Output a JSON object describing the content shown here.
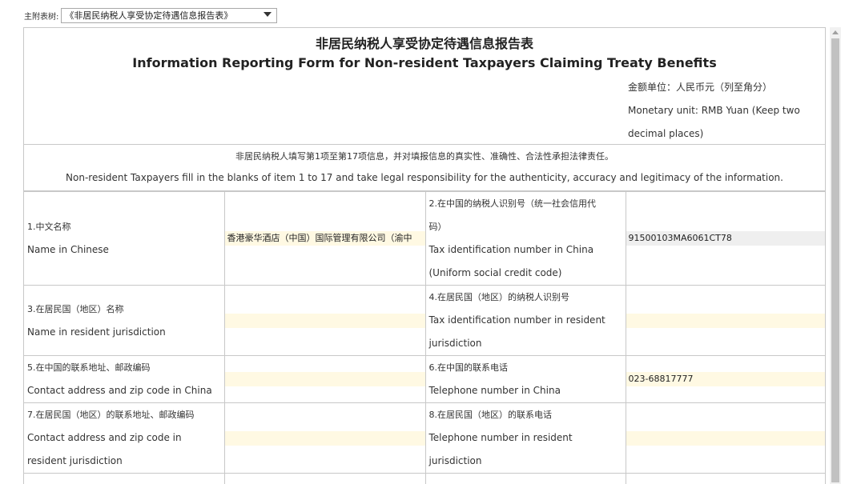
{
  "topbar": {
    "label": "主附表树:",
    "selected": "《非居民纳税人享受协定待遇信息报告表》"
  },
  "form": {
    "title_cn": "非居民纳税人享受协定待遇信息报告表",
    "title_en": "Information Reporting Form for Non-resident Taxpayers Claiming Treaty Benefits",
    "unit_cn": "金额单位：人民币元（列至角分）",
    "unit_en_1": "Monetary unit: RMB Yuan (Keep two",
    "unit_en_2": "decimal places)",
    "notice_cn": "非居民纳税人填写第1项至第17项信息，并对填报信息的真实性、准确性、合法性承担法律责任。",
    "notice_en": "Non-resident Taxpayers fill in the blanks of item 1 to 17 and take legal responsibility for the authenticity, accuracy and legitimacy of the information."
  },
  "rows": [
    {
      "l_cn": "1.中文名称",
      "l_en": "Name in Chinese",
      "l_val": "香港豪华酒店（中国）国际管理有限公司（渝中",
      "r_cn1": "2.在中国的纳税人识别号（统一社会信用代",
      "r_cn2": "码）",
      "r_en1": "Tax identification number in China",
      "r_en2": "(Uniform social credit code)",
      "r_val": "91500103MA6061CT78"
    },
    {
      "l_cn": "3.在居民国（地区）名称",
      "l_en": "Name in resident jurisdiction",
      "l_val": "",
      "r_cn1": "4.在居民国（地区）的纳税人识别号",
      "r_en1": "Tax identification number in resident",
      "r_en2": "jurisdiction",
      "r_val": ""
    },
    {
      "l_cn": "5.在中国的联系地址、邮政编码",
      "l_en": "Contact address and zip code in China",
      "l_val": "",
      "r_cn1": "6.在中国的联系电话",
      "r_en1": "Telephone number in China",
      "r_val": "023-68817777"
    },
    {
      "l_cn": "7.在居民国（地区）的联系地址、邮政编码",
      "l_en1": "Contact address and zip code in",
      "l_en2": "resident jurisdiction",
      "l_val": "",
      "r_cn1": "8.在居民国（地区）的联系电话",
      "r_en1": "Telephone number in resident",
      "r_en2": "jurisdiction",
      "r_val": ""
    }
  ]
}
